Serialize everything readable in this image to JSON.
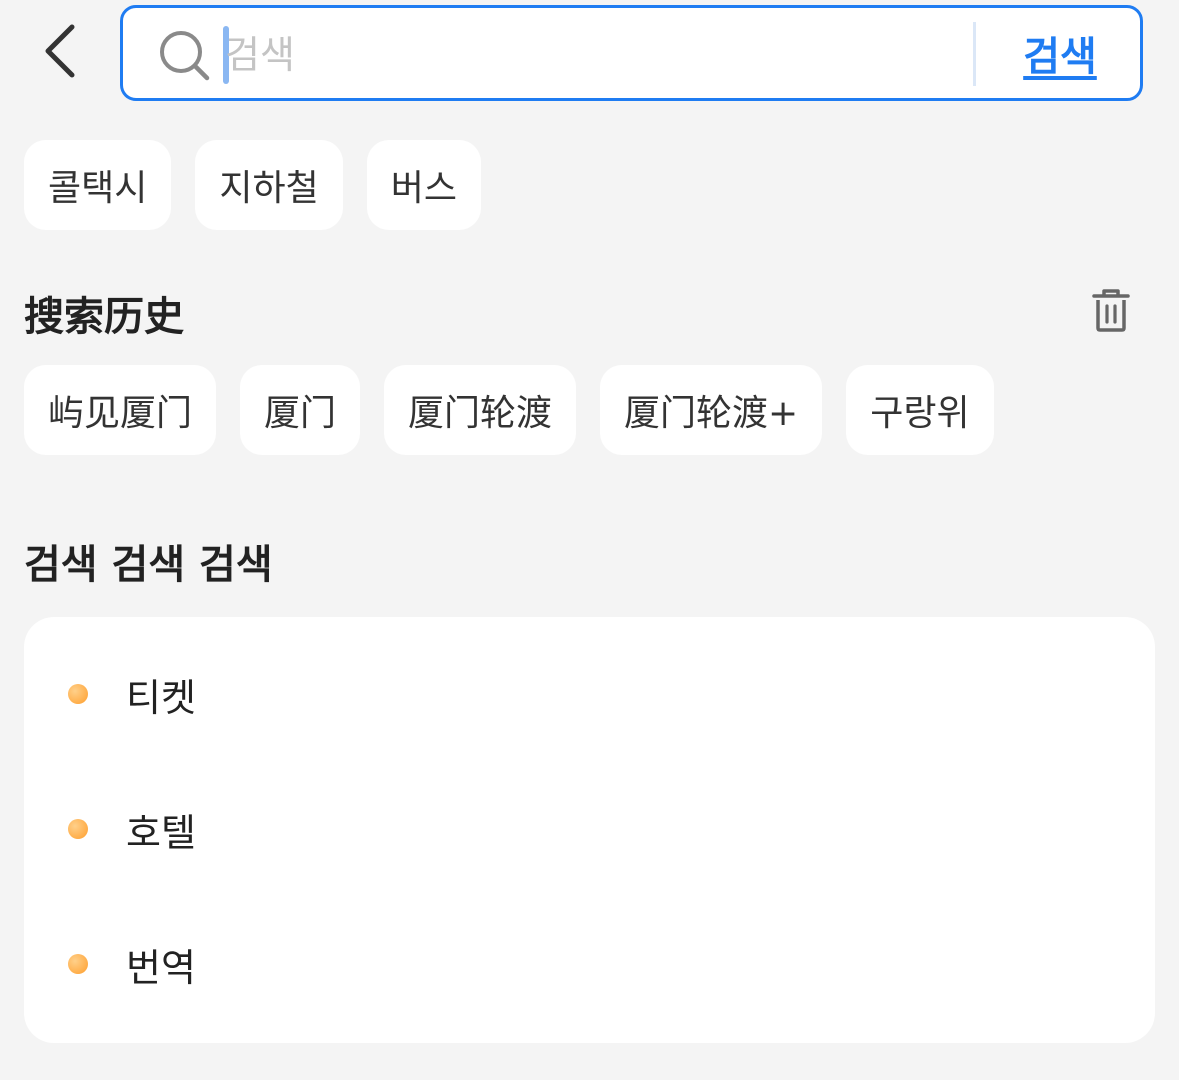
{
  "search": {
    "placeholder": "검색",
    "value": "",
    "submit_label": "검색"
  },
  "quick_chips": [
    "콜택시",
    "지하철",
    "버스"
  ],
  "history": {
    "title": "搜索历史",
    "items": [
      "屿见厦门",
      "厦门",
      "厦门轮渡",
      "厦门轮渡+",
      "구랑위"
    ]
  },
  "recommend": {
    "title": "검색 검색 검색",
    "items": [
      "티켓",
      "호텔",
      "번역"
    ]
  },
  "colors": {
    "accent": "#1f7cf2",
    "background": "#f4f4f4",
    "dot": "#ff9e2c"
  },
  "icons": {
    "back": "chevron-left-icon",
    "search": "search-icon",
    "trash": "trash-icon"
  }
}
